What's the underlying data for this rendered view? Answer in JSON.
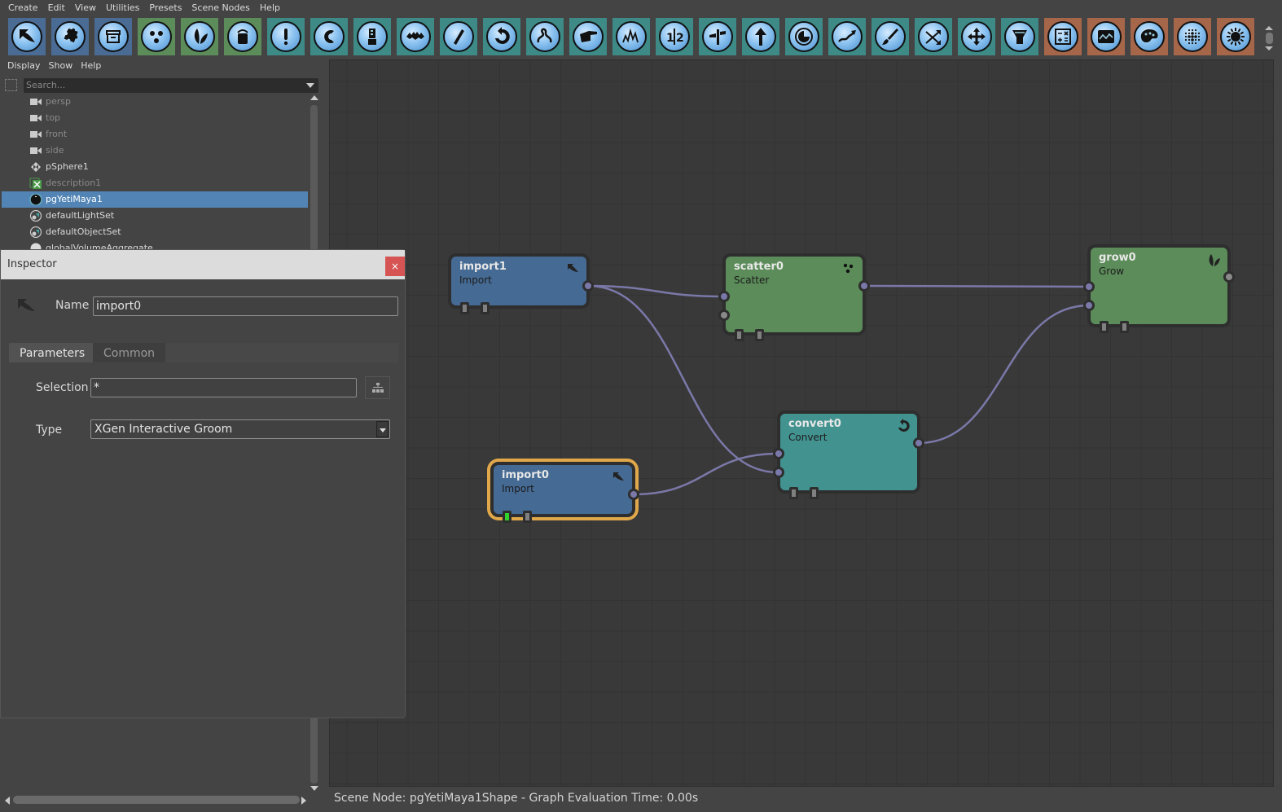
{
  "menubar": [
    "Create",
    "Edit",
    "View",
    "Utilities",
    "Presets",
    "Scene Nodes",
    "Help"
  ],
  "shelf": [
    {
      "name": "import-icon",
      "group": "blue"
    },
    {
      "name": "puzzle-icon",
      "group": "blue"
    },
    {
      "name": "archive-box-icon",
      "group": "blue"
    },
    {
      "name": "scatter-dots-icon",
      "group": "green"
    },
    {
      "name": "grow-leaves-icon",
      "group": "green"
    },
    {
      "name": "bucket-icon",
      "group": "green"
    },
    {
      "name": "exclamation-icon",
      "group": "teal"
    },
    {
      "name": "curl-icon",
      "group": "teal"
    },
    {
      "name": "blender-icon",
      "group": "teal"
    },
    {
      "name": "clump-icon",
      "group": "teal"
    },
    {
      "name": "comb-icon",
      "group": "teal"
    },
    {
      "name": "convert-loop-icon",
      "group": "teal"
    },
    {
      "name": "squiggle-icon",
      "group": "teal"
    },
    {
      "name": "pointing-hand-icon",
      "group": "teal"
    },
    {
      "name": "noise-icon",
      "group": "teal"
    },
    {
      "name": "split-half-icon",
      "group": "teal"
    },
    {
      "name": "signpost-icon",
      "group": "teal"
    },
    {
      "name": "arrow-up-icon",
      "group": "teal"
    },
    {
      "name": "moon-icon",
      "group": "teal"
    },
    {
      "name": "trend-arrow-icon",
      "group": "teal"
    },
    {
      "name": "brush-icon",
      "group": "teal"
    },
    {
      "name": "shuffle-icon",
      "group": "teal"
    },
    {
      "name": "move-icon",
      "group": "teal"
    },
    {
      "name": "filter-width-icon",
      "group": "teal"
    },
    {
      "name": "calculator-icon",
      "group": "orange"
    },
    {
      "name": "image-graph-icon",
      "group": "orange"
    },
    {
      "name": "palette-icon",
      "group": "orange"
    },
    {
      "name": "dot-grid-icon",
      "group": "orange"
    },
    {
      "name": "sunburst-icon",
      "group": "orange"
    }
  ],
  "outliner": {
    "menu": [
      "Display",
      "Show",
      "Help"
    ],
    "search_placeholder": "Search...",
    "items": [
      {
        "label": "persp",
        "icon": "camera-icon",
        "dim": true
      },
      {
        "label": "top",
        "icon": "camera-icon",
        "dim": true
      },
      {
        "label": "front",
        "icon": "camera-icon",
        "dim": true
      },
      {
        "label": "side",
        "icon": "camera-icon",
        "dim": true
      },
      {
        "label": "pSphere1",
        "icon": "transform-icon",
        "dim": false
      },
      {
        "label": "description1",
        "icon": "xgen-description-icon",
        "dim": true
      },
      {
        "label": "pgYetiMaya1",
        "icon": "yeti-icon",
        "dim": false,
        "selected": true
      },
      {
        "label": "defaultLightSet",
        "icon": "object-set-icon",
        "dim": false
      },
      {
        "label": "defaultObjectSet",
        "icon": "object-set-icon",
        "dim": false
      },
      {
        "label": "globalVolumeAggregate",
        "icon": "volume-icon",
        "dim": false
      }
    ]
  },
  "inspector": {
    "title": "Inspector",
    "close_label": "×",
    "name_label": "Name",
    "name_value": "import0",
    "tabs": [
      "Parameters",
      "Common"
    ],
    "active_tab": "Parameters",
    "selection_label": "Selection",
    "selection_value": "*",
    "type_label": "Type",
    "type_value": "XGen Interactive Groom"
  },
  "graph": {
    "nodes": [
      {
        "id": "import1",
        "title": "import1",
        "type": "Import",
        "kind": "import",
        "selected": false
      },
      {
        "id": "scatter0",
        "title": "scatter0",
        "type": "Scatter",
        "kind": "scatter",
        "selected": false
      },
      {
        "id": "grow0",
        "title": "grow0",
        "type": "Grow",
        "kind": "grow",
        "selected": false
      },
      {
        "id": "convert0",
        "title": "convert0",
        "type": "Convert",
        "kind": "convert",
        "selected": false
      },
      {
        "id": "import0",
        "title": "import0",
        "type": "Import",
        "kind": "import",
        "selected": true
      }
    ],
    "connections": [
      {
        "from": "import1",
        "to": "scatter0",
        "to_port": 0
      },
      {
        "from": "import1",
        "to": "convert0",
        "to_port": 1
      },
      {
        "from": "import0",
        "to": "convert0",
        "to_port": 0
      },
      {
        "from": "scatter0",
        "to": "grow0",
        "to_port": 0
      },
      {
        "from": "convert0",
        "to": "grow0",
        "to_port": 1
      }
    ],
    "colors": {
      "import": "#456a93",
      "scatter": "#5b8c59",
      "grow": "#5b8c59",
      "convert": "#429290",
      "selection": "#e0a84a",
      "link": "#7a78a8"
    }
  },
  "status": "Scene Node: pgYetiMaya1Shape - Graph Evaluation Time: 0.00s"
}
